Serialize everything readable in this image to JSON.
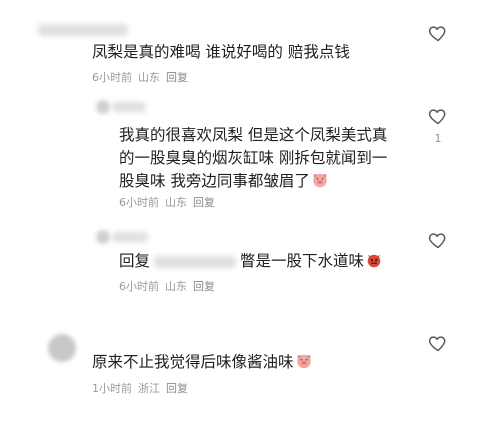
{
  "comments": [
    {
      "text": "凤梨是真的难喝 谁说好喝的 赔我点钱",
      "time": "6小时前",
      "location": "山东",
      "reply_label": "回复",
      "likes": ""
    },
    {
      "lines": [
        "我真的很喜欢凤梨 但是这个凤梨美式真",
        "的一股臭臭的烟灰缸味 刚拆包就闻到一",
        "股臭味 我旁边同事都皱眉了"
      ],
      "emoji": "pig-face-emoji",
      "time": "6小时前",
      "location": "山东",
      "reply_label": "回复",
      "likes": "1"
    },
    {
      "prefix": "回复",
      "suffix": "瞥是一股下水道味",
      "emoji": "devil-face-emoji",
      "time": "6小时前",
      "location": "山东",
      "reply_label": "回复",
      "likes": ""
    },
    {
      "text": "原来不止我觉得后味像酱油味",
      "emoji": "pig-face-emoji",
      "time": "1小时前",
      "location": "浙江",
      "reply_label": "回复",
      "likes": ""
    }
  ],
  "colors": {
    "text": "#1f1f1f",
    "meta": "#9a9a9a",
    "heart_stroke": "#5a5a5a",
    "pig": "#f4a7a7",
    "devil": "#d94a3a"
  }
}
